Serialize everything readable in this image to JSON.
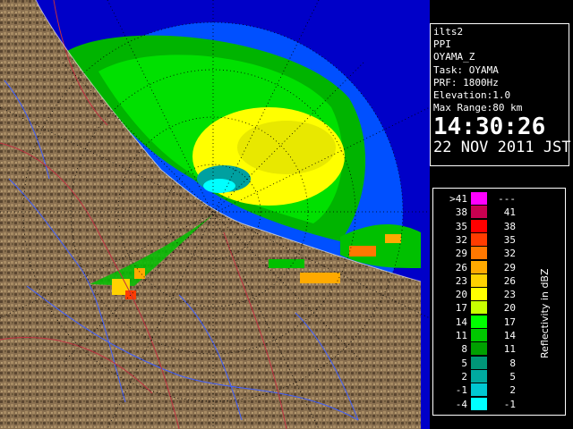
{
  "info": {
    "station": "ilts2",
    "mode": "PPI",
    "product": "OYAMA_Z",
    "task": "Task: OYAMA",
    "prf": "PRF: 1800Hz",
    "elevation": "Elevation:1.0",
    "max_range": "Max Range:80 km",
    "time": "14:30:26",
    "date": "22 NOV 2011 JST"
  },
  "legend": {
    "title": "Reflectivity in dBZ",
    "rows": [
      {
        "lo": ">41",
        "hi": "---",
        "color": "#ff00ff"
      },
      {
        "lo": "38",
        "hi": "41",
        "color": "#c80050"
      },
      {
        "lo": "35",
        "hi": "38",
        "color": "#ff0000"
      },
      {
        "lo": "32",
        "hi": "35",
        "color": "#ff3c00"
      },
      {
        "lo": "29",
        "hi": "32",
        "color": "#ff7800"
      },
      {
        "lo": "26",
        "hi": "29",
        "color": "#ffaa00"
      },
      {
        "lo": "23",
        "hi": "26",
        "color": "#ffd200"
      },
      {
        "lo": "20",
        "hi": "23",
        "color": "#ffff00"
      },
      {
        "lo": "17",
        "hi": "20",
        "color": "#c8ff00"
      },
      {
        "lo": "14",
        "hi": "17",
        "color": "#00ff00"
      },
      {
        "lo": "11",
        "hi": "14",
        "color": "#00c800"
      },
      {
        "lo": "8",
        "hi": "11",
        "color": "#00a000"
      },
      {
        "lo": "5",
        "hi": "8",
        "color": "#009678"
      },
      {
        "lo": "2",
        "hi": "5",
        "color": "#00aaa0"
      },
      {
        "lo": "-1",
        "hi": "2",
        "color": "#00c8d2"
      },
      {
        "lo": "-4",
        "hi": "-1",
        "color": "#00ffff"
      }
    ]
  },
  "colors": {
    "sea": "#0000c8",
    "range_area": "#0050ff",
    "terrain": "#8a7050",
    "river": "#4060ff",
    "border": "#c03040"
  }
}
